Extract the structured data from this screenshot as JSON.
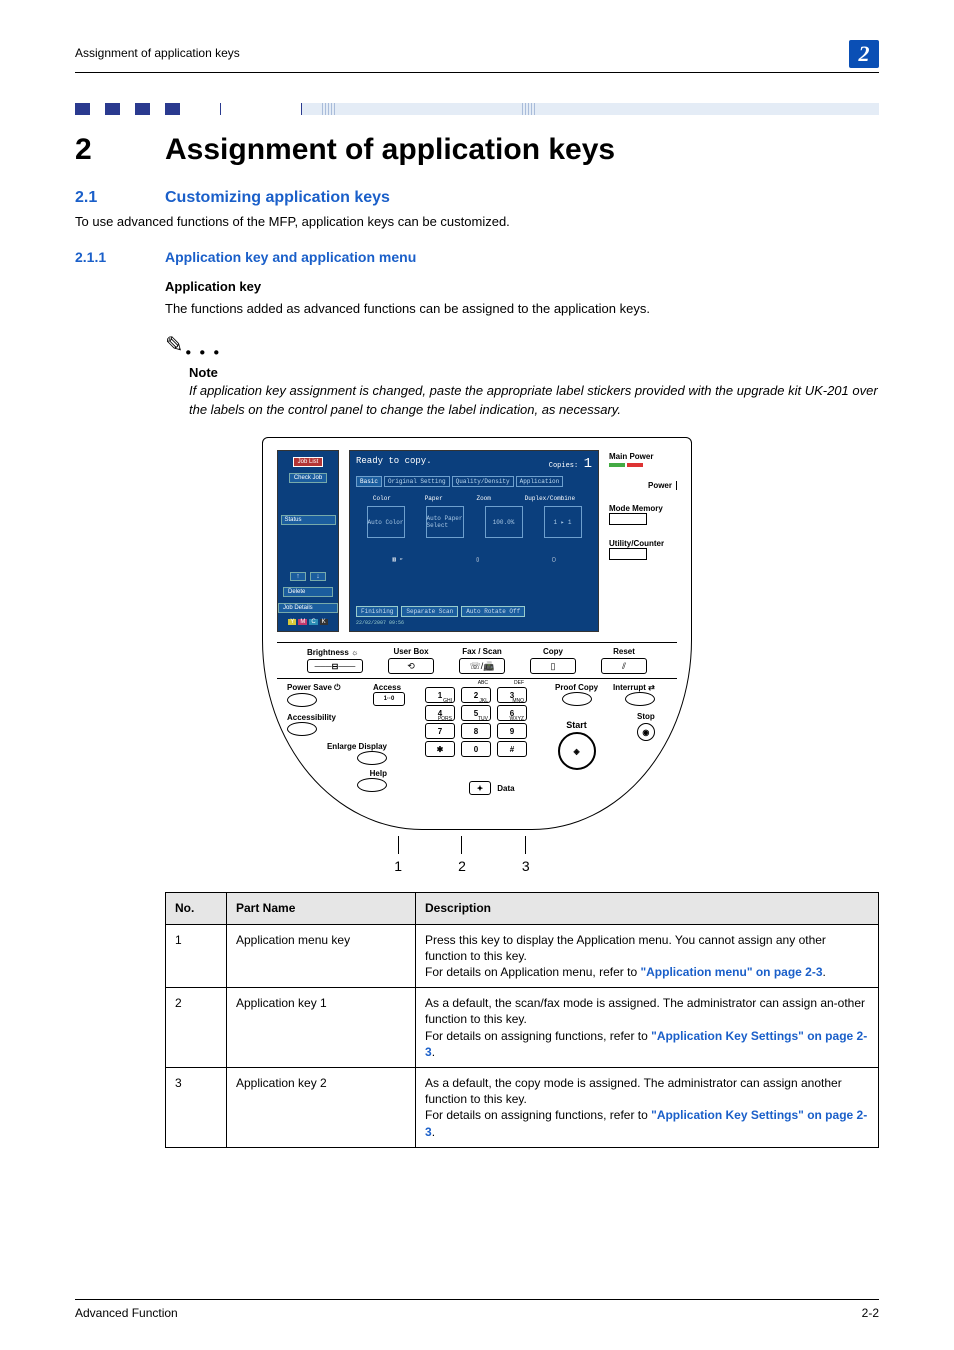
{
  "header": {
    "running_title": "Assignment of application keys",
    "chapter_badge": "2"
  },
  "title": {
    "num": "2",
    "text": "Assignment of application keys"
  },
  "sec21": {
    "num": "2.1",
    "text": "Customizing application keys",
    "body": "To use advanced functions of the MFP, application keys can be customized."
  },
  "sec211": {
    "num": "2.1.1",
    "text": "Application key and application menu"
  },
  "app_key": {
    "heading": "Application key",
    "body": "The functions added as advanced functions can be assigned to the application keys."
  },
  "note": {
    "label": "Note",
    "text": "If application key assignment is changed, paste the appropriate label stickers provided with the upgrade kit UK-201 over the labels on the control panel to change the label indication, as necessary."
  },
  "panel": {
    "lcd_side": {
      "job_list": "Job List",
      "check_job": "Check Job",
      "status": "Status",
      "delete": "Delete",
      "job_details": "Job Details",
      "chips": [
        "Y",
        "M",
        "C",
        "K"
      ]
    },
    "lcd_main": {
      "ready": "Ready to copy.",
      "copies_label": "Copies:",
      "copies_val": "1",
      "tabs": [
        "Basic",
        "Original Setting",
        "Quality/Density",
        "Application"
      ],
      "labels": [
        "Color",
        "Paper",
        "Zoom",
        "Duplex/Combine"
      ],
      "btns": [
        "Auto Color",
        "Auto Paper Select",
        "100.0%",
        "1 ▸ 1"
      ],
      "bottom": [
        "Finishing",
        "Separate Scan",
        "Auto Rotate Off"
      ],
      "timestamp": "22/02/2007 09:56"
    },
    "right_labels": {
      "main_power": "Main Power",
      "power": "Power",
      "mode_memory": "Mode Memory",
      "utility": "Utility/Counter"
    },
    "mid": {
      "brightness": "Brightness ☼",
      "user_box": "User Box",
      "fax_scan": "Fax / Scan",
      "copy": "Copy",
      "reset": "Reset"
    },
    "controls": {
      "power_save": "Power Save ⏻",
      "accessibility": "Accessibility",
      "enlarge_display": "Enlarge Display",
      "help": "Help",
      "access": "Access",
      "access_sub": "1··0",
      "proof_copy": "Proof Copy",
      "interrupt": "Interrupt ⇄",
      "stop": "Stop",
      "start": "Start",
      "data": "Data",
      "keypad": [
        "1",
        "2",
        "3",
        "4",
        "5",
        "6",
        "7",
        "8",
        "9",
        "✱",
        "0",
        "#"
      ],
      "keypad_sup": [
        "",
        "ABC",
        "DEF",
        "GHI",
        "JKL",
        "MNO",
        "PQRS",
        "TUV",
        "WXYZ",
        "",
        "",
        ""
      ]
    },
    "callouts": [
      "1",
      "2",
      "3"
    ]
  },
  "table": {
    "headers": [
      "No.",
      "Part Name",
      "Description"
    ],
    "rows": [
      {
        "no": "1",
        "part": "Application menu key",
        "desc_pre": "Press this key to display the Application menu. You cannot assign any other function to this key.\nFor details on Application menu, refer to ",
        "link": "\"Application menu\" on page 2-3",
        "desc_post": "."
      },
      {
        "no": "2",
        "part": "Application key 1",
        "desc_pre": "As a default, the scan/fax mode is assigned. The administrator can assign an-other function to this key.\nFor details on assigning functions, refer to ",
        "link": "\"Application Key Settings\" on page 2-3",
        "desc_post": "."
      },
      {
        "no": "3",
        "part": "Application key 2",
        "desc_pre": "As a default, the copy mode is assigned. The administrator can assign another function to this key.\nFor details on assigning functions, refer to ",
        "link": "\"Application Key Settings\" on page 2-3",
        "desc_post": "."
      }
    ]
  },
  "footer": {
    "left": "Advanced Function",
    "right": "2-2"
  }
}
